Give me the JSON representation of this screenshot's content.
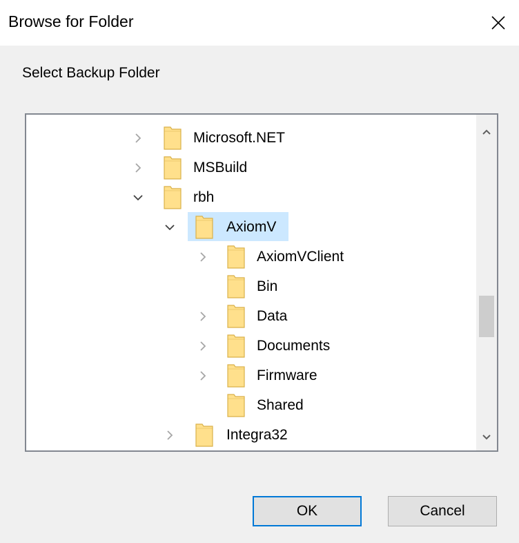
{
  "window": {
    "title": "Browse for Folder"
  },
  "prompt": "Select Backup Folder",
  "tree": {
    "items": [
      {
        "label": "Microsoft.NET",
        "level": 0,
        "expander": "collapsed",
        "selected": false
      },
      {
        "label": "MSBuild",
        "level": 0,
        "expander": "collapsed",
        "selected": false
      },
      {
        "label": "rbh",
        "level": 0,
        "expander": "expanded",
        "selected": false
      },
      {
        "label": "AxiomV",
        "level": 1,
        "expander": "expanded",
        "selected": true
      },
      {
        "label": "AxiomVClient",
        "level": 2,
        "expander": "collapsed",
        "selected": false
      },
      {
        "label": "Bin",
        "level": 2,
        "expander": "none",
        "selected": false
      },
      {
        "label": "Data",
        "level": 2,
        "expander": "collapsed",
        "selected": false
      },
      {
        "label": "Documents",
        "level": 2,
        "expander": "collapsed",
        "selected": false
      },
      {
        "label": "Firmware",
        "level": 2,
        "expander": "collapsed",
        "selected": false
      },
      {
        "label": "Shared",
        "level": 2,
        "expander": "none",
        "selected": false
      },
      {
        "label": "Integra32",
        "level": 1,
        "expander": "collapsed",
        "selected": false
      }
    ]
  },
  "buttons": {
    "ok": "OK",
    "cancel": "Cancel"
  },
  "icons": {
    "close": "close-icon",
    "folder": "folder-icon",
    "chevron_right": "chevron-right-icon",
    "chevron_down": "chevron-down-icon",
    "scroll_up": "scroll-up-arrow-icon",
    "scroll_down": "scroll-down-arrow-icon"
  },
  "colors": {
    "selection": "#cce8ff",
    "folder_fill": "#ffe08c",
    "folder_stroke": "#d9b14a",
    "ok_border": "#0078d7"
  }
}
